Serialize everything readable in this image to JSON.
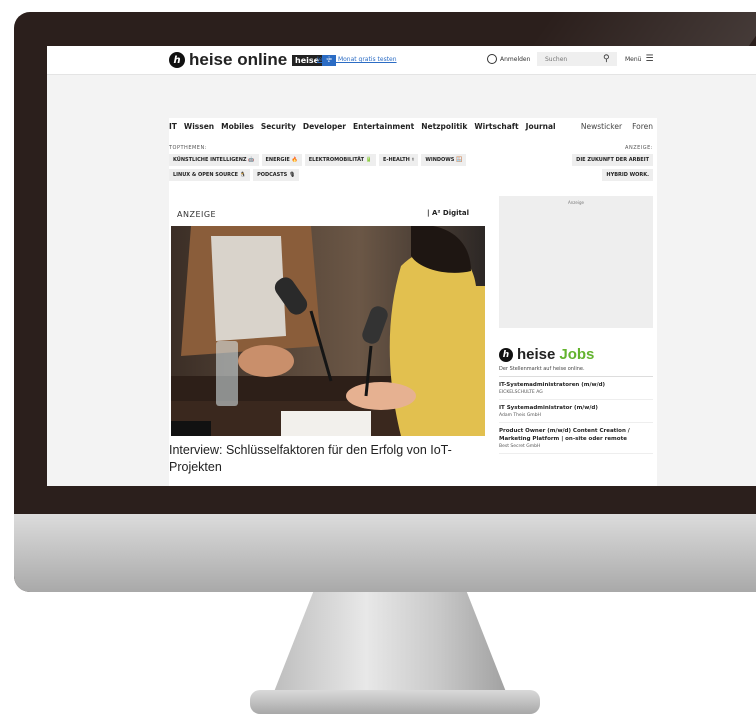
{
  "header": {
    "logo_text": "heise online",
    "heiseplus_word": "heise",
    "heiseplus_plus": "+",
    "promo_text": "Jetzt 1 Monat gratis testen",
    "login_label": "Anmelden",
    "search_placeholder": "Suchen",
    "menu_label": "Menü"
  },
  "nav": {
    "items": [
      "IT",
      "Wissen",
      "Mobiles",
      "Security",
      "Developer",
      "Entertainment",
      "Netzpolitik",
      "Wirtschaft",
      "Journal"
    ],
    "right": [
      "Newsticker",
      "Foren"
    ]
  },
  "topthemen": {
    "label": "TOPTHEMEN:",
    "chips": [
      "KÜNSTLICHE INTELLIGENZ 🤖",
      "ENERGIE 🔥",
      "ELEKTROMOBILITÄT 🔋",
      "E-HEALTH ⚕",
      "WINDOWS 🪟",
      "LINUX & OPEN SOURCE 🐧",
      "PODCASTS 🎙"
    ]
  },
  "anzeige_topics": {
    "label": "ANZEIGE:",
    "chips": [
      "DIE ZUKUNFT DER ARBEIT",
      "HYBRID WORK."
    ]
  },
  "ad": {
    "label": "ANZEIGE",
    "brand": "| A² Digital",
    "headline": "Interview: Schlüsselfaktoren für den Erfolg von IoT-Projekten"
  },
  "sidebar_ad": {
    "label": "Anzeige"
  },
  "jobs": {
    "logo_word1": "heise",
    "logo_word2": "Jobs",
    "subtitle": "Der Stellenmarkt auf heise online.",
    "listings": [
      {
        "title": "IT-Systemadministratoren (m/w/d)",
        "company": "EICKELSCHULTE AG"
      },
      {
        "title": "IT Systemadministrator (m/w/d)",
        "company": "Adam Theis GmbH"
      },
      {
        "title": "Product Owner (m/w/d) Content Creation / Marketing Platform | on-site oder remote",
        "company": "Best Secret GmbH"
      }
    ]
  }
}
